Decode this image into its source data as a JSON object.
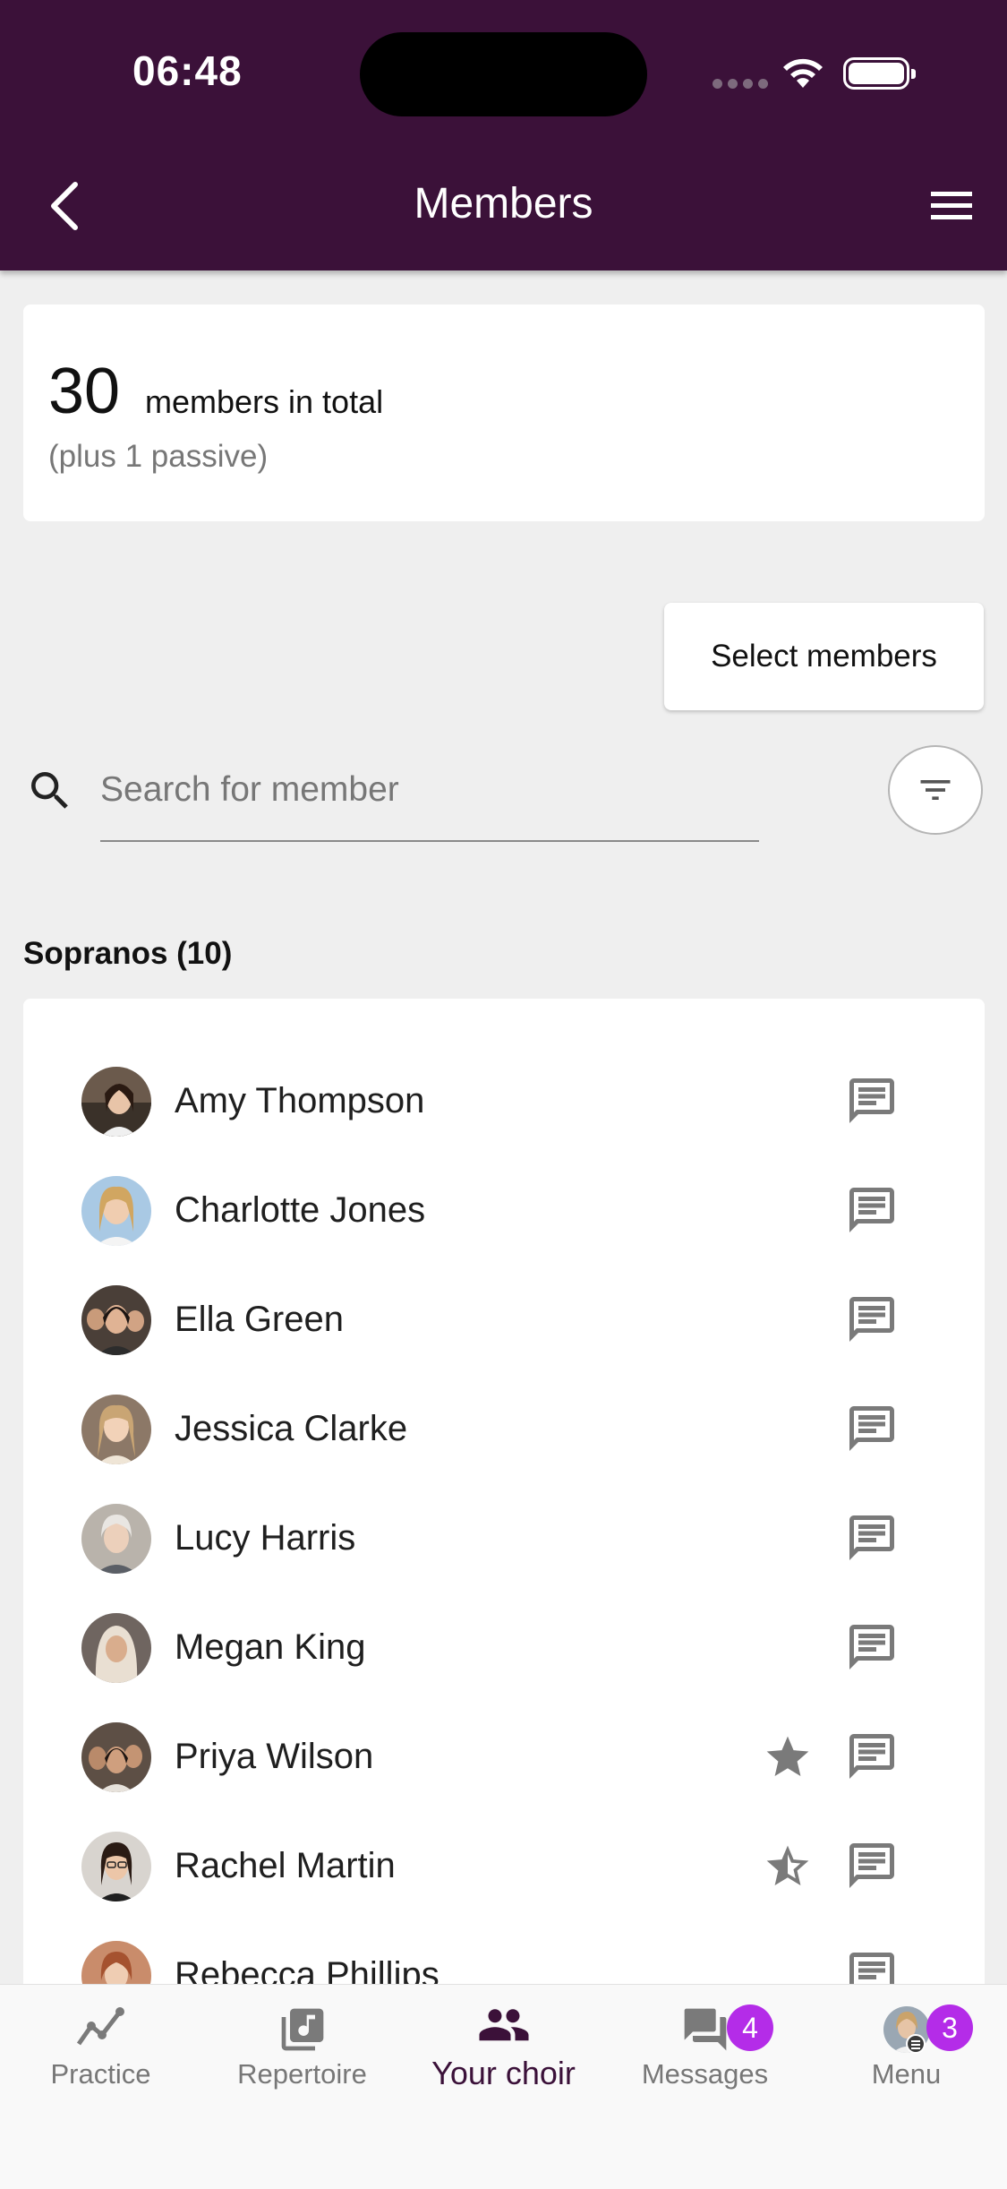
{
  "status_bar": {
    "time": "06:48"
  },
  "header": {
    "title": "Members"
  },
  "summary": {
    "count": "30",
    "label": "members in total",
    "sub": "(plus 1 passive)"
  },
  "actions": {
    "select_members": "Select members"
  },
  "search": {
    "placeholder": "Search for member"
  },
  "section": {
    "title": "Sopranos (10)"
  },
  "members": [
    {
      "name": "Amy Thompson",
      "starred": "none"
    },
    {
      "name": "Charlotte Jones",
      "starred": "none"
    },
    {
      "name": "Ella Green",
      "starred": "none"
    },
    {
      "name": "Jessica Clarke",
      "starred": "none"
    },
    {
      "name": "Lucy Harris",
      "starred": "none"
    },
    {
      "name": "Megan King",
      "starred": "none"
    },
    {
      "name": "Priya Wilson",
      "starred": "full"
    },
    {
      "name": "Rachel Martin",
      "starred": "half"
    },
    {
      "name": "Rebecca Phillips",
      "starred": "none"
    }
  ],
  "bottom_nav": {
    "items": [
      {
        "label": "Practice",
        "icon": "chart-line-icon"
      },
      {
        "label": "Repertoire",
        "icon": "music-library-icon"
      },
      {
        "label": "Your choir",
        "icon": "group-icon"
      },
      {
        "label": "Messages",
        "icon": "forum-icon",
        "badge": "4"
      },
      {
        "label": "Menu",
        "icon": "avatar-menu-icon",
        "badge": "3"
      }
    ],
    "active": "Your choir"
  },
  "colors": {
    "header": "#3b1139",
    "badge": "#b42ce8",
    "icon_gray": "#7a7a7a"
  }
}
